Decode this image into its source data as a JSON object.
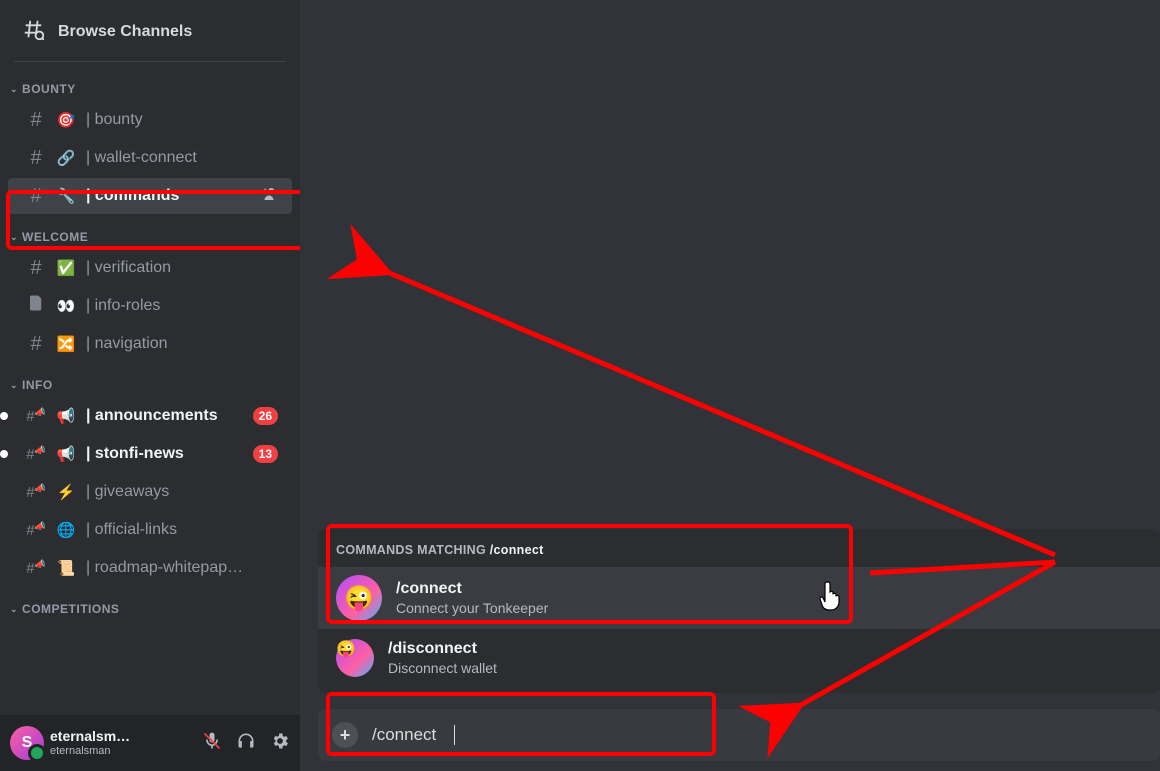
{
  "sidebar": {
    "browse_label": "Browse Channels",
    "categories": [
      {
        "name": "BOUNTY",
        "channels": [
          {
            "emoji": "🎯",
            "label": "| bounty",
            "style": "dim"
          },
          {
            "emoji": "🔗",
            "label": "| wallet-connect",
            "style": "dim"
          },
          {
            "emoji": "🔧",
            "label": "| commands",
            "style": "sel",
            "highlight": true,
            "has_add_user": true
          }
        ]
      },
      {
        "name": "WELCOME",
        "channels": [
          {
            "emoji": "✅",
            "label": "| verification",
            "style": "dim"
          },
          {
            "emoji": "👀",
            "label": "| info-roles",
            "style": "dim",
            "type": "rules"
          },
          {
            "emoji": "🔀",
            "label": "| navigation",
            "style": "dim"
          }
        ]
      },
      {
        "name": "INFO",
        "channels": [
          {
            "emoji": "📢",
            "label": "| announcements",
            "style": "bright",
            "badge": "26",
            "unread": true,
            "type": "announce"
          },
          {
            "emoji": "📢",
            "label": "| stonfi-news",
            "style": "bright",
            "badge": "13",
            "unread": true,
            "type": "announce"
          },
          {
            "emoji": "⚡",
            "label": "| giveaways",
            "style": "dim",
            "type": "announce"
          },
          {
            "emoji": "🌐",
            "label": "| official-links",
            "style": "dim",
            "type": "announce"
          },
          {
            "emoji": "📜",
            "label": "| roadmap-whitepap…",
            "style": "dim",
            "type": "announce"
          }
        ]
      },
      {
        "name": "COMPETITIONS",
        "channels": []
      }
    ]
  },
  "user": {
    "initial": "S",
    "name": "eternalsm…",
    "sub": "eternalsman"
  },
  "commands": {
    "header_prefix": "COMMANDS MATCHING ",
    "header_query": "/connect",
    "items": [
      {
        "title": "/connect",
        "sub": "Connect your Tonkeeper",
        "selected": true
      },
      {
        "title": "/disconnect",
        "sub": "Disconnect wallet",
        "selected": false
      }
    ]
  },
  "input": {
    "typed": "/connect"
  }
}
